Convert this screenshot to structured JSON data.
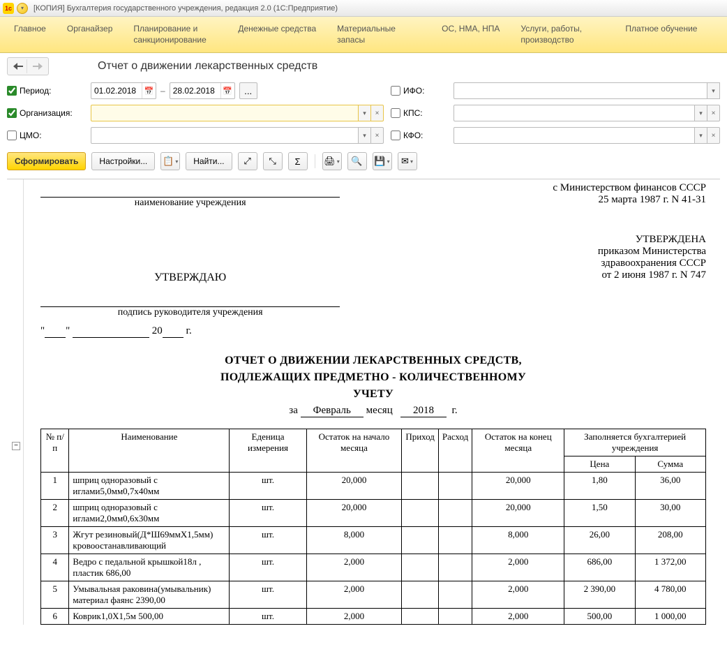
{
  "titlebar": {
    "text": "[КОПИЯ] Бухгалтерия государственного учреждения, редакция 2.0  (1С:Предприятие)"
  },
  "mainmenu": {
    "items": [
      "Главное",
      "Органайзер",
      "Планирование и санкционирование",
      "Денежные средства",
      "Материальные запасы",
      "ОС, НМА, НПА",
      "Услуги, работы, производство",
      "Платное обучение"
    ]
  },
  "header": {
    "title": "Отчет о движении лекарственных средств"
  },
  "filters": {
    "period": {
      "label": "Период:",
      "checked": true,
      "from": "01.02.2018",
      "dash": "–",
      "to": "28.02.2018"
    },
    "org": {
      "label": "Организация:",
      "checked": true,
      "value": ""
    },
    "cmo": {
      "label": "ЦМО:",
      "checked": false,
      "value": ""
    },
    "ifo": {
      "label": "ИФО:",
      "checked": false,
      "value": ""
    },
    "kps": {
      "label": "КПС:",
      "checked": false,
      "value": ""
    },
    "kfo": {
      "label": "КФО:",
      "checked": false,
      "value": ""
    },
    "ellipsis": "..."
  },
  "toolbar": {
    "generate": "Сформировать",
    "settings": "Настройки...",
    "find": "Найти..."
  },
  "report": {
    "inst_label": "наименование учреждения",
    "approve": "УТВЕРЖДАЮ",
    "sign_label": "подпись руководителя учреждения",
    "date_tpl_quote1": "\"",
    "date_tpl_quote2": "\"",
    "date_20": "20",
    "date_g": "г.",
    "right_l1": "с Министерством финансов СССР",
    "right_l2": "25 марта 1987 г. N 41-31",
    "right_l3": "УТВЕРЖДЕНА",
    "right_l4": "приказом Министерства",
    "right_l5": "здравоохранения СССР",
    "right_l6": "от 2 июня 1987 г. N 747",
    "title_l1": "ОТЧЕТ О ДВИЖЕНИИ ЛЕКАРСТВЕННЫХ СРЕДСТВ,",
    "title_l2": "ПОДЛЕЖАЩИХ ПРЕДМЕТНО - КОЛИЧЕСТВЕННОМУ",
    "title_l3": "УЧЕТУ",
    "period_za": "за",
    "period_month": "Февраль",
    "period_mes": "месяц",
    "period_year": "2018",
    "period_g": "г."
  },
  "table": {
    "headers": {
      "num": "№ п/п",
      "name": "Наименование",
      "unit": "Еденица измерения",
      "start": "Остаток на начало месяца",
      "income": "Приход",
      "expense": "Расход",
      "end": "Остаток на конец месяца",
      "acc": "Заполняется бухгалтерией учреждения",
      "price": "Цена",
      "sum": "Сумма"
    },
    "rows": [
      {
        "n": "1",
        "name": "шприц одноразовый с иглами5,0мм0,7х40мм",
        "unit": "шт.",
        "start": "20,000",
        "income": "",
        "expense": "",
        "end": "20,000",
        "price": "1,80",
        "sum": "36,00"
      },
      {
        "n": "2",
        "name": "шприц одноразовый с иглами2,0мм0,6х30мм",
        "unit": "шт.",
        "start": "20,000",
        "income": "",
        "expense": "",
        "end": "20,000",
        "price": "1,50",
        "sum": "30,00"
      },
      {
        "n": "3",
        "name": "Жгут резиновый(Д*Ш69ммХ1,5мм) кровоостанавливающий",
        "unit": "шт.",
        "start": "8,000",
        "income": "",
        "expense": "",
        "end": "8,000",
        "price": "26,00",
        "sum": "208,00"
      },
      {
        "n": "4",
        "name": "Ведро с педальной крышкой18л , пластик 686,00",
        "unit": "шт.",
        "start": "2,000",
        "income": "",
        "expense": "",
        "end": "2,000",
        "price": "686,00",
        "sum": "1 372,00"
      },
      {
        "n": "5",
        "name": "Умывальная раковина(умывальник) материал фаянс 2390,00",
        "unit": "шт.",
        "start": "2,000",
        "income": "",
        "expense": "",
        "end": "2,000",
        "price": "2 390,00",
        "sum": "4 780,00"
      },
      {
        "n": "6",
        "name": "Коврик1,0Х1,5м 500,00",
        "unit": "шт.",
        "start": "2,000",
        "income": "",
        "expense": "",
        "end": "2,000",
        "price": "500,00",
        "sum": "1 000,00"
      }
    ]
  }
}
